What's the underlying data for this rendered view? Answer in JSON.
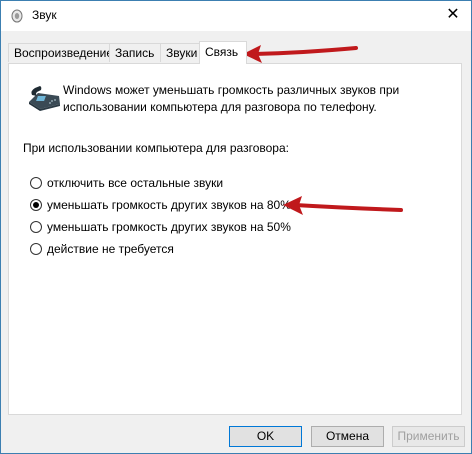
{
  "window": {
    "title": "Звук",
    "close_glyph": "✕"
  },
  "tabs": [
    {
      "label": "Воспроизведение",
      "active": false
    },
    {
      "label": "Запись",
      "active": false
    },
    {
      "label": "Звуки",
      "active": false
    },
    {
      "label": "Связь",
      "active": true
    }
  ],
  "communications": {
    "description": "Windows может уменьшать громкость различных звуков при использовании компьютера для разговора по телефону.",
    "group_label": "При использовании компьютера для разговора:",
    "options": [
      {
        "label": "отключить все остальные звуки",
        "checked": false
      },
      {
        "label": "уменьшать громкость других звуков на 80%",
        "checked": true
      },
      {
        "label": "уменьшать громкость других звуков на 50%",
        "checked": false
      },
      {
        "label": "действие не требуется",
        "checked": false
      }
    ]
  },
  "buttons": {
    "ok": "OK",
    "cancel": "Отмена",
    "apply": "Применить"
  },
  "colors": {
    "annotation_arrow": "#c0191c",
    "window_border": "#3c7fb1",
    "default_button_border": "#0078d7"
  }
}
